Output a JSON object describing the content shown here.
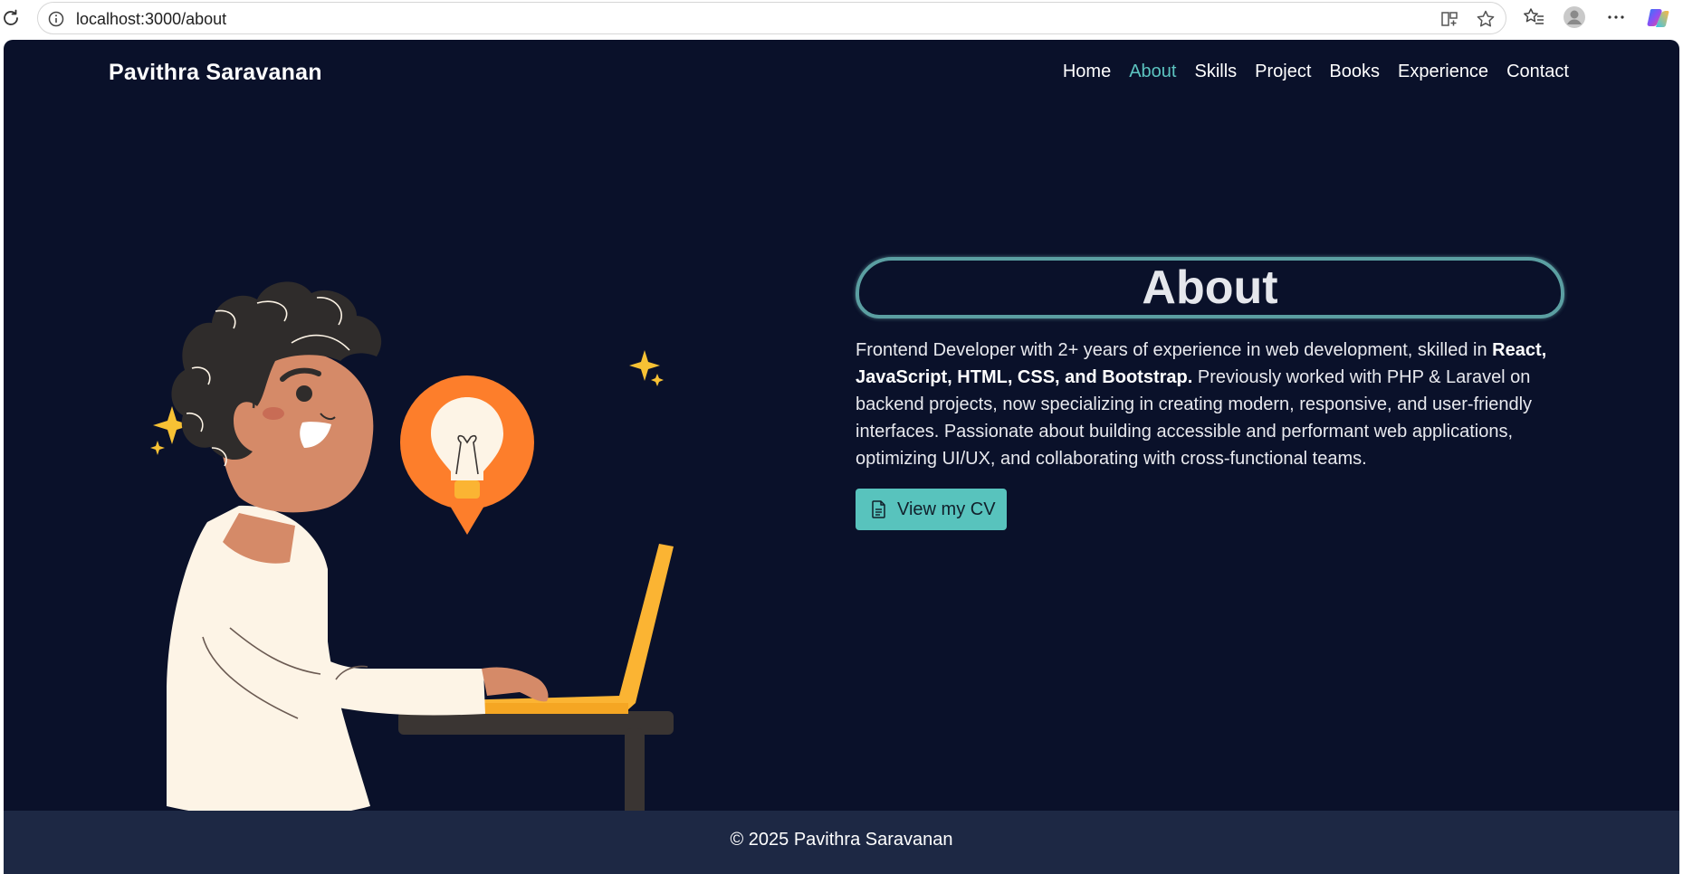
{
  "browser": {
    "url": "localhost:3000/about",
    "icons": [
      "reload-icon",
      "info-icon",
      "split-screen-icon",
      "favorite-star-icon",
      "favorites-icon",
      "profile-icon",
      "more-icon",
      "copilot-icon"
    ]
  },
  "header": {
    "brand": "Pavithra Saravanan",
    "nav": [
      {
        "label": "Home",
        "active": false
      },
      {
        "label": "About",
        "active": true
      },
      {
        "label": "Skills",
        "active": false
      },
      {
        "label": "Project",
        "active": false
      },
      {
        "label": "Books",
        "active": false
      },
      {
        "label": "Experience",
        "active": false
      },
      {
        "label": "Contact",
        "active": false
      }
    ]
  },
  "about": {
    "title": "About",
    "bio": {
      "part1": "Frontend Developer with 2+ years of experience in web development, skilled in ",
      "bold": "React, JavaScript, HTML, CSS, and Bootstrap.",
      "part2": " Previously worked with PHP & Laravel on backend projects, now specializing in creating modern, responsive, and user-friendly interfaces. Passionate about building accessible and performant web applications, optimizing UI/UX, and collaborating with cross-functional teams."
    },
    "cv_button": "View my CV"
  },
  "footer": {
    "copyright": "© 2025 Pavithra Saravanan"
  },
  "colors": {
    "background": "#0a112a",
    "footer": "#1d2844",
    "accent": "#58c3bd",
    "active_nav": "#5cc4c0"
  }
}
